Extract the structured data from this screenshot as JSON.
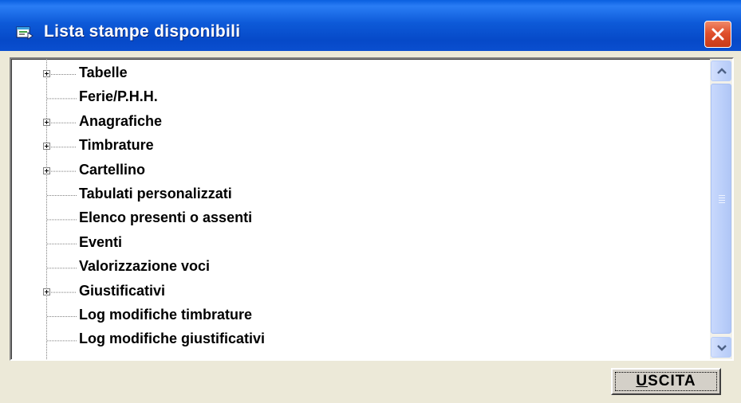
{
  "window": {
    "title": "Lista stampe disponibili",
    "icon": "window-app-icon",
    "close_icon": "close-icon"
  },
  "tree": {
    "items": [
      {
        "label": "Tabelle",
        "expandable": true
      },
      {
        "label": "Ferie/P.H.H.",
        "expandable": false
      },
      {
        "label": "Anagrafiche",
        "expandable": true
      },
      {
        "label": "Timbrature",
        "expandable": true
      },
      {
        "label": "Cartellino",
        "expandable": true
      },
      {
        "label": "Tabulati personalizzati",
        "expandable": false
      },
      {
        "label": "Elenco presenti o assenti",
        "expandable": false
      },
      {
        "label": "Eventi",
        "expandable": false
      },
      {
        "label": "Valorizzazione voci",
        "expandable": false
      },
      {
        "label": "Giustificativi",
        "expandable": true
      },
      {
        "label": "Log modifiche timbrature",
        "expandable": false
      },
      {
        "label": "Log modifiche giustificativi",
        "expandable": false
      }
    ]
  },
  "scrollbar": {
    "up_icon": "scroll-up-arrow-icon",
    "down_icon": "scroll-down-arrow-icon",
    "visible_fraction": 0.92
  },
  "footer": {
    "exit_button_accel": "U",
    "exit_button_rest": "SCITA"
  },
  "colors": {
    "title_bar": "#0a5fe0",
    "face": "#ece9d8",
    "close_button": "#e0502c"
  }
}
